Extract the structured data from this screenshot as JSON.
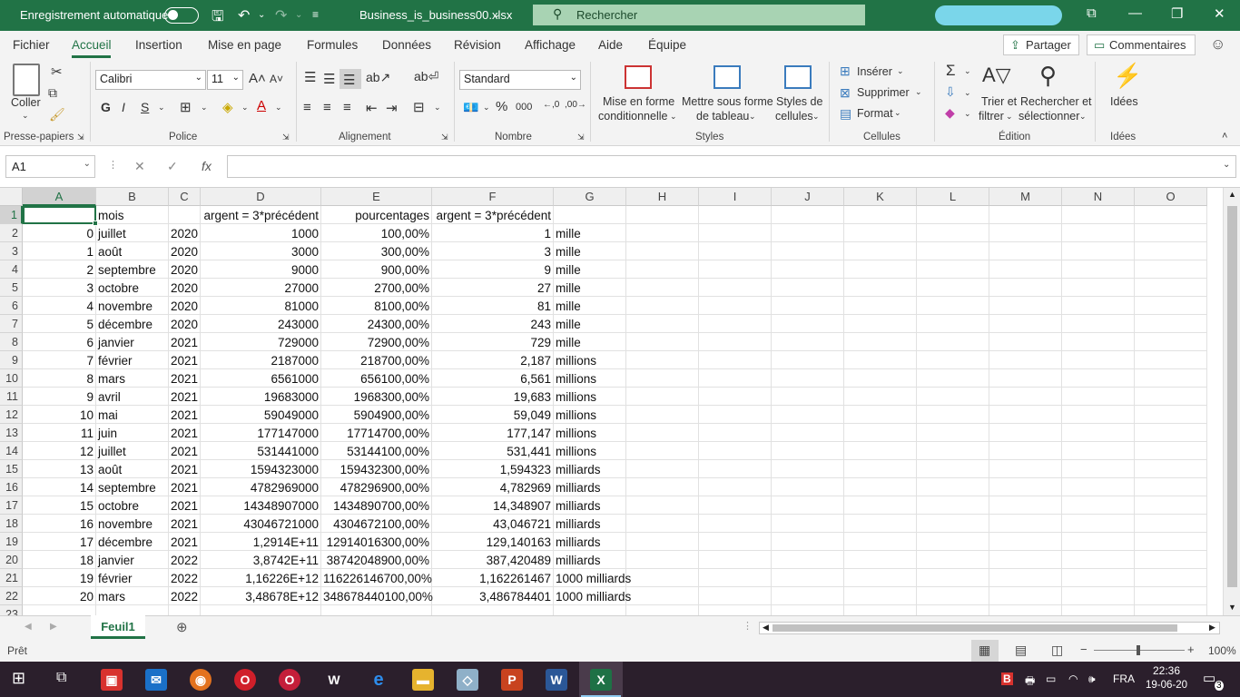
{
  "titlebar": {
    "autosave_label": "Enregistrement automatique",
    "file_name": "Business_is_business00.xlsx",
    "search_placeholder": "Rechercher"
  },
  "menu": {
    "items": [
      "Fichier",
      "Accueil",
      "Insertion",
      "Mise en page",
      "Formules",
      "Données",
      "Révision",
      "Affichage",
      "Aide",
      "Équipe"
    ],
    "active": "Accueil",
    "share_label": "Partager",
    "comments_label": "Commentaires"
  },
  "ribbon": {
    "groups": {
      "clipboard": "Presse-papiers",
      "font": "Police",
      "alignment": "Alignement",
      "number": "Nombre",
      "styles": "Styles",
      "cells": "Cellules",
      "editing": "Édition",
      "ideas": "Idées"
    },
    "paste_label": "Coller",
    "font_name": "Calibri",
    "font_size": "11",
    "number_format": "Standard",
    "conditional_1": "Mise en forme",
    "conditional_2": "conditionnelle",
    "table_1": "Mettre sous forme",
    "table_2": "de tableau",
    "cellstyles_1": "Styles de",
    "cellstyles_2": "cellules",
    "insert": "Insérer",
    "delete": "Supprimer",
    "format": "Format",
    "sort_1": "Trier et",
    "sort_2": "filtrer",
    "find_1": "Rechercher et",
    "find_2": "sélectionner",
    "ideas": "Idées",
    "bold": "G",
    "italic": "I",
    "underline": "S"
  },
  "formula_bar": {
    "name_box": "A1",
    "fx": "fx",
    "content": ""
  },
  "sheet": {
    "columns": [
      "A",
      "B",
      "C",
      "D",
      "E",
      "F",
      "G",
      "H",
      "I",
      "J",
      "K",
      "L",
      "M",
      "N",
      "O"
    ],
    "rows": [
      [
        "",
        "mois",
        "",
        "argent = 3*précédent",
        "pourcentages",
        "argent = 3*précédent",
        ""
      ],
      [
        "0",
        "juillet",
        "2020",
        "1000",
        "100,00%",
        "1",
        "mille"
      ],
      [
        "1",
        "août",
        "2020",
        "3000",
        "300,00%",
        "3",
        "mille"
      ],
      [
        "2",
        "septembre",
        "2020",
        "9000",
        "900,00%",
        "9",
        "mille"
      ],
      [
        "3",
        "octobre",
        "2020",
        "27000",
        "2700,00%",
        "27",
        "mille"
      ],
      [
        "4",
        "novembre",
        "2020",
        "81000",
        "8100,00%",
        "81",
        "mille"
      ],
      [
        "5",
        "décembre",
        "2020",
        "243000",
        "24300,00%",
        "243",
        "mille"
      ],
      [
        "6",
        "janvier",
        "2021",
        "729000",
        "72900,00%",
        "729",
        "mille"
      ],
      [
        "7",
        "février",
        "2021",
        "2187000",
        "218700,00%",
        "2,187",
        "millions"
      ],
      [
        "8",
        "mars",
        "2021",
        "6561000",
        "656100,00%",
        "6,561",
        "millions"
      ],
      [
        "9",
        "avril",
        "2021",
        "19683000",
        "1968300,00%",
        "19,683",
        "millions"
      ],
      [
        "10",
        "mai",
        "2021",
        "59049000",
        "5904900,00%",
        "59,049",
        "millions"
      ],
      [
        "11",
        "juin",
        "2021",
        "177147000",
        "17714700,00%",
        "177,147",
        "millions"
      ],
      [
        "12",
        "juillet",
        "2021",
        "531441000",
        "53144100,00%",
        "531,441",
        "millions"
      ],
      [
        "13",
        "août",
        "2021",
        "1594323000",
        "159432300,00%",
        "1,594323",
        "milliards"
      ],
      [
        "14",
        "septembre",
        "2021",
        "4782969000",
        "478296900,00%",
        "4,782969",
        "milliards"
      ],
      [
        "15",
        "octobre",
        "2021",
        "14348907000",
        "1434890700,00%",
        "14,348907",
        "milliards"
      ],
      [
        "16",
        "novembre",
        "2021",
        "43046721000",
        "4304672100,00%",
        "43,046721",
        "milliards"
      ],
      [
        "17",
        "décembre",
        "2021",
        "1,2914E+11",
        "12914016300,00%",
        "129,140163",
        "milliards"
      ],
      [
        "18",
        "janvier",
        "2022",
        "3,8742E+11",
        "38742048900,00%",
        "387,420489",
        "milliards"
      ],
      [
        "19",
        "février",
        "2022",
        "1,16226E+12",
        "116226146700,00%",
        "1,162261467",
        "1000 milliards"
      ],
      [
        "20",
        "mars",
        "2022",
        "3,48678E+12",
        "348678440100,00%",
        "3,486784401",
        "1000 milliards"
      ]
    ],
    "tab_name": "Feuil1"
  },
  "status": {
    "ready": "Prêt",
    "zoom": "100%"
  },
  "taskbar": {
    "lang": "FRA",
    "time": "22:36",
    "date": "19-06-20",
    "notif_count": "3"
  }
}
